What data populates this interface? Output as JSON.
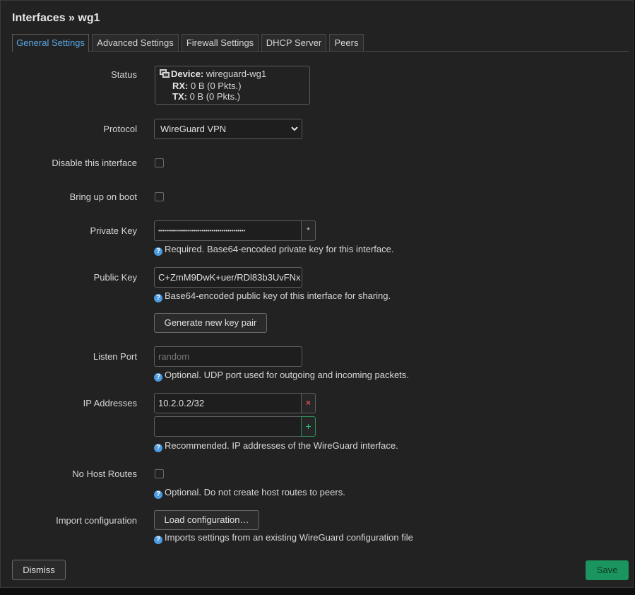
{
  "title": "Interfaces » wg1",
  "tabs": [
    {
      "label": "General Settings",
      "active": true
    },
    {
      "label": "Advanced Settings",
      "active": false
    },
    {
      "label": "Firewall Settings",
      "active": false
    },
    {
      "label": "DHCP Server",
      "active": false
    },
    {
      "label": "Peers",
      "active": false
    }
  ],
  "status": {
    "label": "Status",
    "icon": "network-device-icon",
    "device_key": "Device:",
    "device_val": "wireguard-wg1",
    "rx_key": "RX:",
    "rx_val": "0 B (0 Pkts.)",
    "tx_key": "TX:",
    "tx_val": "0 B (0 Pkts.)"
  },
  "protocol": {
    "label": "Protocol",
    "value": "WireGuard VPN"
  },
  "disable": {
    "label": "Disable this interface",
    "checked": false
  },
  "bootup": {
    "label": "Bring up on boot",
    "checked": false
  },
  "private_key": {
    "label": "Private Key",
    "value": "••••••••••••••••••••••••••••••••••••••••••••",
    "reveal": "*",
    "hint": "Required. Base64-encoded private key for this interface."
  },
  "public_key": {
    "label": "Public Key",
    "value": "C+ZmM9DwK+uer/RDl83b3UvFNx",
    "hint": "Base64-encoded public key of this interface for sharing."
  },
  "generate_button": "Generate new key pair",
  "listen_port": {
    "label": "Listen Port",
    "placeholder": "random",
    "hint": "Optional. UDP port used for outgoing and incoming packets."
  },
  "ip_addresses": {
    "label": "IP Addresses",
    "value": "10.2.0.2/32",
    "remove": "×",
    "add": "+",
    "hint": "Recommended. IP addresses of the WireGuard interface."
  },
  "no_host_routes": {
    "label": "No Host Routes",
    "checked": false,
    "hint": "Optional. Do not create host routes to peers."
  },
  "import_config": {
    "label": "Import configuration",
    "button": "Load configuration…",
    "hint": "Imports settings from an existing WireGuard configuration file"
  },
  "footer": {
    "dismiss": "Dismiss",
    "save": "Save"
  },
  "colors": {
    "accent": "#5aa9e6",
    "save": "#1a9560",
    "remove": "#d9534f",
    "add": "#2ecc71",
    "hint_icon": "#4c9be0"
  }
}
